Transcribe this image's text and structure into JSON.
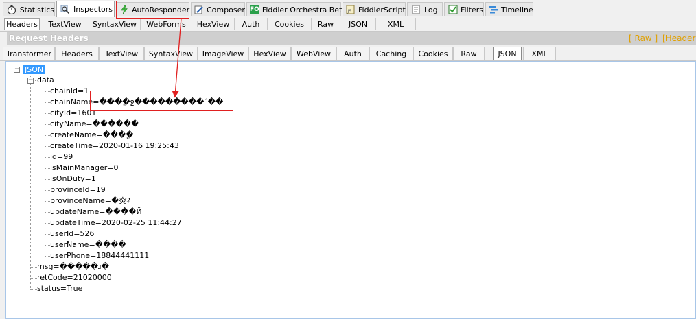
{
  "main_tabs": [
    {
      "label": "Statistics",
      "icon": "stopwatch-icon"
    },
    {
      "label": "Inspectors",
      "icon": "magnifier-icon"
    },
    {
      "label": "AutoResponder",
      "icon": "lightning-icon"
    },
    {
      "label": "Composer",
      "icon": "pencil-icon"
    },
    {
      "label": "Fiddler Orchestra Beta",
      "icon": "fo-icon"
    },
    {
      "label": "FiddlerScript",
      "icon": "script-icon"
    },
    {
      "label": "Log",
      "icon": "log-icon"
    },
    {
      "label": "Filters",
      "icon": "checkbox-icon"
    },
    {
      "label": "Timeline",
      "icon": "timeline-icon"
    }
  ],
  "request_tabs": [
    "Headers",
    "TextView",
    "SyntaxView",
    "WebForms",
    "HexView",
    "Auth",
    "Cookies",
    "Raw",
    "JSON",
    "XML"
  ],
  "request_headers": {
    "title": "Request Headers",
    "raw_link": "[ Raw ]",
    "header_link": "[Header "
  },
  "response_tabs": [
    "Transformer",
    "Headers",
    "TextView",
    "SyntaxView",
    "ImageView",
    "HexView",
    "WebView",
    "Auth",
    "Caching",
    "Cookies",
    "Raw",
    "JSON",
    "XML"
  ],
  "tree": {
    "root": "JSON",
    "data_label": "data",
    "data_items": [
      "chainId=1",
      "chainName=���ֳ�ջ���������´��",
      "cityId=1601",
      "cityName=������",
      "createName=���ֳ�",
      "createTime=2020-01-16 19:25:43",
      "id=99",
      "isMainManager=0",
      "isOnDuty=1",
      "provinceId=19",
      "provinceName=�㶫ʡ",
      "updateName=����Й",
      "updateTime=2020-02-25 11:44:27",
      "userId=526",
      "userName=����",
      "userPhone=18844441111"
    ],
    "tail_items": [
      "msg=�����ɹ�",
      "retCode=21020000",
      "status=True"
    ]
  },
  "colors": {
    "highlight": "#3399ff",
    "annotation": "#e02020",
    "link": "#e0a000"
  }
}
